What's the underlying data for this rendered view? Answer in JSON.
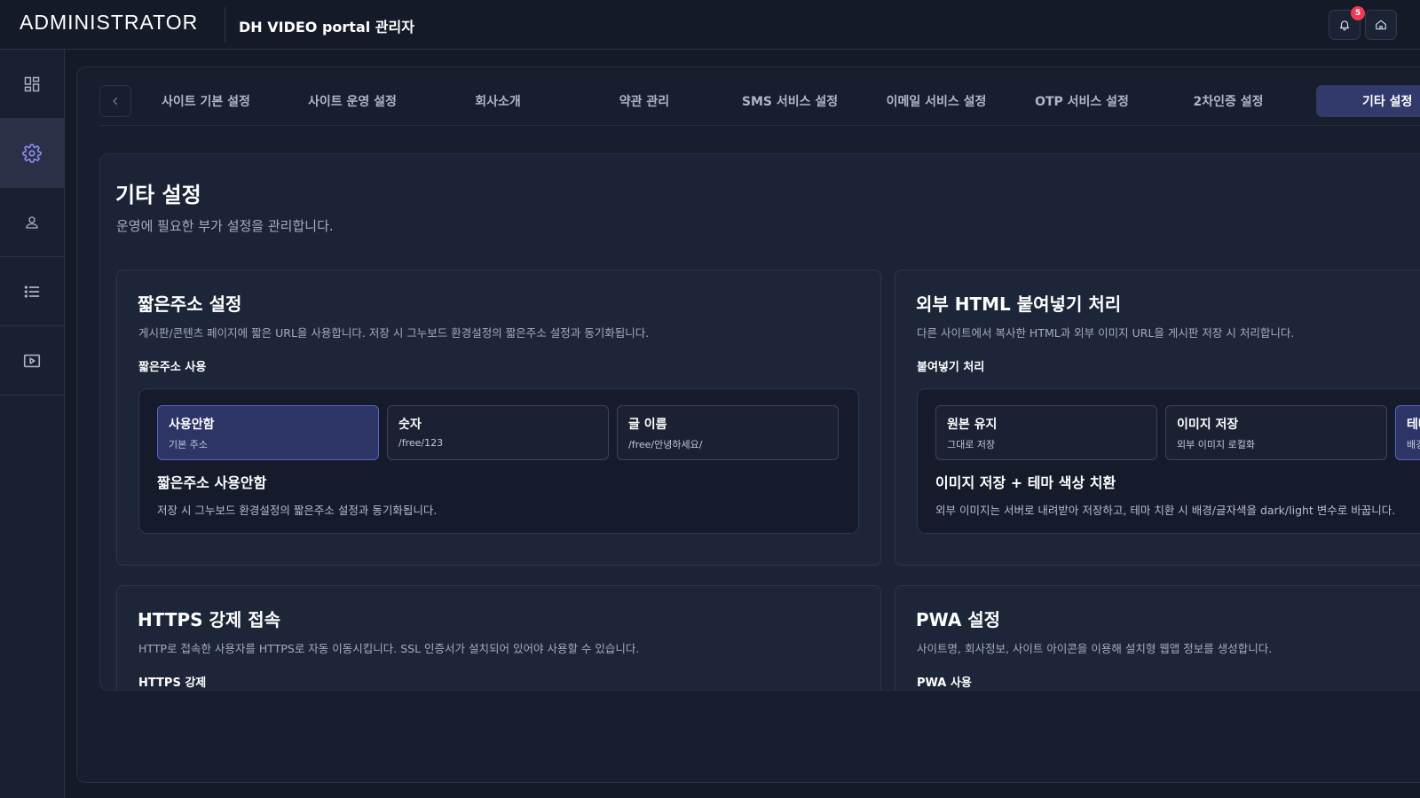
{
  "header": {
    "brand": "ADMINISTRATOR",
    "title": "DH VIDEO portal 관리자",
    "notification_count": "5",
    "icons": [
      "bell-icon",
      "home-icon"
    ]
  },
  "sidebar": {
    "items": [
      {
        "icon": "dashboard-icon",
        "active": false
      },
      {
        "icon": "gear-icon",
        "active": true
      },
      {
        "icon": "user-icon",
        "active": false
      },
      {
        "icon": "list-icon",
        "active": false
      },
      {
        "icon": "video-icon",
        "active": false
      }
    ]
  },
  "tabs": [
    {
      "label": "사이트 기본 설정"
    },
    {
      "label": "사이트 운영 설정"
    },
    {
      "label": "회사소개"
    },
    {
      "label": "약관 관리"
    },
    {
      "label": "SMS 서비스 설정"
    },
    {
      "label": "이메일 서비스 설정"
    },
    {
      "label": "OTP 서비스 설정"
    },
    {
      "label": "2차인증 설정"
    },
    {
      "label": "기타 설정",
      "active": true
    }
  ],
  "page": {
    "title": "기타 설정",
    "description": "운영에 필요한 부가 설정을 관리합니다."
  },
  "cards": {
    "short_url": {
      "title": "짧은주소 설정",
      "description": "게시판/콘텐츠 페이지에 짧은 URL을 사용합니다. 저장 시 그누보드 환경설정의 짧은주소 설정과 동기화됩니다.",
      "label": "짧은주소 사용",
      "options": [
        {
          "title": "사용안함",
          "sub": "기본 주소",
          "selected": true
        },
        {
          "title": "숫자",
          "sub": "/free/123",
          "selected": false
        },
        {
          "title": "글 이름",
          "sub": "/free/안녕하세요/",
          "selected": false
        }
      ],
      "selected_title": "짧은주소 사용안함",
      "selected_desc": "저장 시 그누보드 환경설정의 짧은주소 설정과 동기화됩니다."
    },
    "external_html": {
      "title": "외부 HTML 붙여넣기 처리",
      "description": "다른 사이트에서 복사한 HTML과 외부 이미지 URL을 게시판 저장 시 처리합니다.",
      "label": "붙여넣기 처리",
      "options": [
        {
          "title": "원본 유지",
          "sub": "그대로 저장",
          "selected": false
        },
        {
          "title": "이미지 저장",
          "sub": "외부 이미지 로컬화",
          "selected": false
        },
        {
          "title": "테마",
          "sub": "배경",
          "selected": true
        }
      ],
      "selected_title": "이미지 저장 + 테마 색상 치환",
      "selected_desc": "외부 이미지는 서버로 내려받아 저장하고, 테마 치환 시 배경/글자색을 dark/light 변수로 바꿉니다."
    },
    "https": {
      "title": "HTTPS 강제 접속",
      "description": "HTTP로 접속한 사용자를 HTTPS로 자동 이동시킵니다. SSL 인증서가 설치되어 있어야 사용할 수 있습니다.",
      "label": "HTTPS 강제"
    },
    "pwa": {
      "title": "PWA 설정",
      "description": "사이트명, 회사정보, 사이트 아이콘을 이용해 설치형 웹앱 정보를 생성합니다.",
      "label": "PWA 사용"
    }
  },
  "colors": {
    "background": "#141a27",
    "accent": "#5663c9",
    "active_tab": "#323a6b",
    "badge": "#ef3a57"
  }
}
